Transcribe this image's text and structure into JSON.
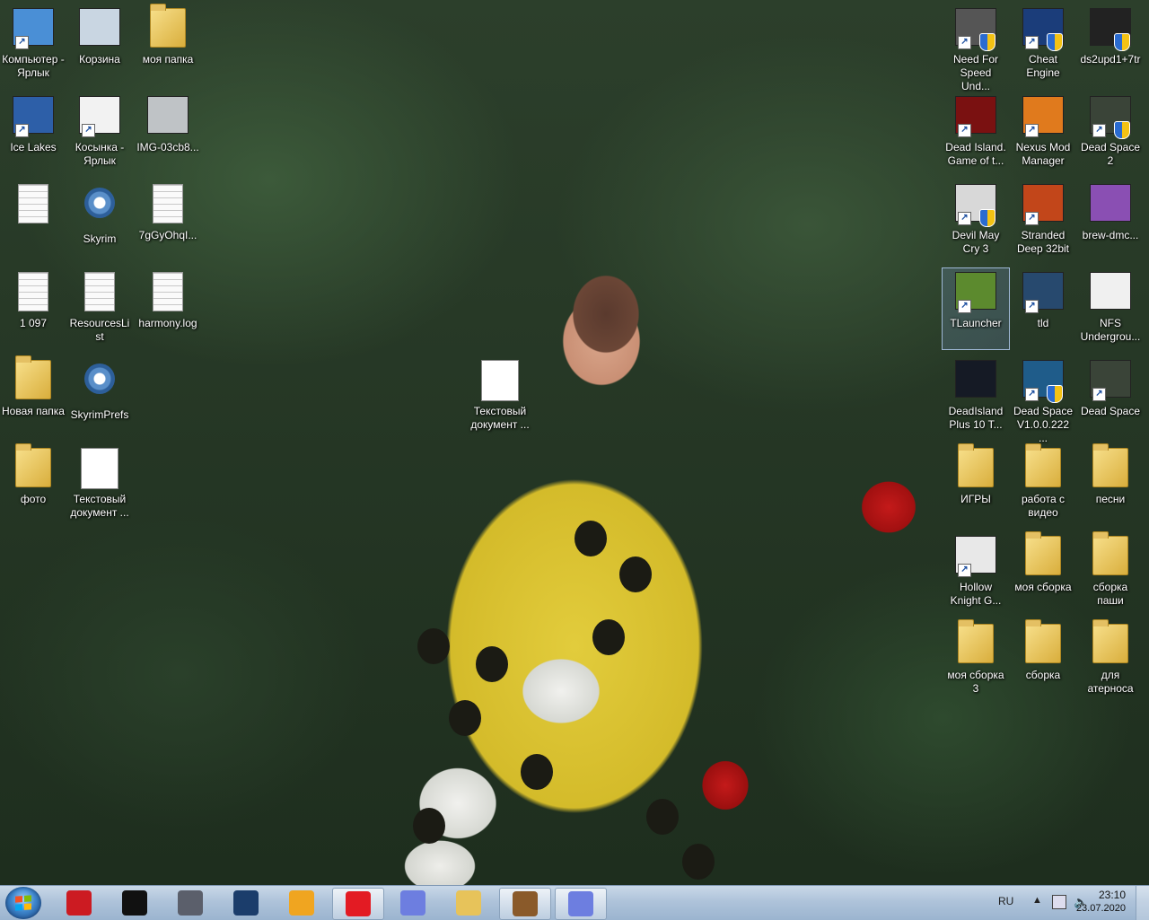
{
  "desktop": {
    "left_icons": [
      {
        "label": "Компьютер - Ярлык",
        "kind": "computer",
        "shortcut": true
      },
      {
        "label": "Корзина",
        "kind": "recycle-bin",
        "shortcut": false
      },
      {
        "label": "моя папка",
        "kind": "folder",
        "shortcut": false
      },
      {
        "label": "Ice Lakes",
        "kind": "game",
        "shortcut": true
      },
      {
        "label": "Косынка - Ярлык",
        "kind": "cards",
        "shortcut": true
      },
      {
        "label": "IMG-03cb8...",
        "kind": "image",
        "shortcut": false
      },
      {
        "label": "",
        "kind": "text-file",
        "shortcut": false
      },
      {
        "label": "Skyrim",
        "kind": "settings-file",
        "shortcut": false
      },
      {
        "label": "7gGyOhqI...",
        "kind": "document",
        "shortcut": false
      },
      {
        "label": "1 097",
        "kind": "text-file",
        "shortcut": false
      },
      {
        "label": "ResourcesList",
        "kind": "xml-file",
        "shortcut": false
      },
      {
        "label": "harmony.log",
        "kind": "text-file",
        "shortcut": false
      },
      {
        "label": "Новая папка",
        "kind": "folder",
        "shortcut": false
      },
      {
        "label": "SkyrimPrefs",
        "kind": "settings-file",
        "shortcut": false
      },
      {
        "label": "фото",
        "kind": "folder",
        "shortcut": false
      },
      {
        "label": "Текстовый документ ...",
        "kind": "blank-document",
        "shortcut": false
      },
      {
        "label": "Текстовый документ ...",
        "kind": "blank-document",
        "shortcut": false
      }
    ],
    "right_icons": [
      {
        "label": "Need For Speed Und...",
        "kind": "nfs",
        "shortcut": true,
        "shield": true
      },
      {
        "label": "Cheat Engine",
        "kind": "cheat-engine",
        "shortcut": true,
        "shield": true
      },
      {
        "label": "ds2upd1+7tr",
        "kind": "trainer",
        "shortcut": false,
        "shield": true
      },
      {
        "label": "Dead Island. Game of t...",
        "kind": "dead-island",
        "shortcut": true,
        "shield": false
      },
      {
        "label": "Nexus Mod Manager",
        "kind": "nexus",
        "shortcut": true,
        "shield": false
      },
      {
        "label": "Dead Space 2",
        "kind": "dead-space",
        "shortcut": true,
        "shield": true
      },
      {
        "label": "Devil May Cry 3",
        "kind": "dmc",
        "shortcut": true,
        "shield": true
      },
      {
        "label": "Stranded Deep 32bit",
        "kind": "stranded",
        "shortcut": true,
        "shield": false
      },
      {
        "label": "brew-dmc...",
        "kind": "brew",
        "shortcut": false,
        "shield": false
      },
      {
        "label": "TLauncher",
        "kind": "minecraft",
        "shortcut": true,
        "shield": false
      },
      {
        "label": "tld",
        "kind": "tld",
        "shortcut": true,
        "shield": false
      },
      {
        "label": "NFS Undergrou...",
        "kind": "nfs-files",
        "shortcut": false,
        "shield": false
      },
      {
        "label": "DeadIsland Plus 10 T...",
        "kind": "dead-island-trainer",
        "shortcut": false,
        "shield": false
      },
      {
        "label": "Dead Space V1.0.0.222 ...",
        "kind": "dead-space-trainer",
        "shortcut": true,
        "shield": true
      },
      {
        "label": "Dead Space",
        "kind": "dead-space",
        "shortcut": true,
        "shield": false
      },
      {
        "label": "ИГРЫ",
        "kind": "folder",
        "shortcut": false,
        "shield": false
      },
      {
        "label": "работа с видео",
        "kind": "folder",
        "shortcut": false,
        "shield": false
      },
      {
        "label": "песни",
        "kind": "folder",
        "shortcut": false,
        "shield": false
      },
      {
        "label": "Hollow Knight G...",
        "kind": "hollow-knight",
        "shortcut": true,
        "shield": false
      },
      {
        "label": "моя сборка",
        "kind": "folder",
        "shortcut": false,
        "shield": false
      },
      {
        "label": "сборка паши",
        "kind": "folder",
        "shortcut": false,
        "shield": false
      },
      {
        "label": "моя сборка 3",
        "kind": "folder",
        "shortcut": false,
        "shield": false
      },
      {
        "label": "сборка",
        "kind": "folder",
        "shortcut": false,
        "shield": false
      },
      {
        "label": "для атерноса",
        "kind": "folder",
        "shortcut": false,
        "shield": false
      }
    ]
  },
  "taskbar": {
    "pinned": [
      {
        "name": "opera",
        "icon": "opera-icon",
        "color": "#cc1b22",
        "active": false
      },
      {
        "name": "terminal-app",
        "icon": "t-app-icon",
        "color": "#111111",
        "active": false
      },
      {
        "name": "game-app",
        "icon": "assassin-icon",
        "color": "#5b5f6b",
        "active": false
      },
      {
        "name": "steam",
        "icon": "steam-icon",
        "color": "#1b3d6b",
        "active": false
      },
      {
        "name": "duck-app",
        "icon": "duck-icon",
        "color": "#f0a520",
        "active": false
      },
      {
        "name": "yandex",
        "icon": "yandex-icon",
        "color": "#e31b23",
        "active": true
      },
      {
        "name": "discord",
        "icon": "discord-icon",
        "color": "#6d7ee0",
        "active": false
      },
      {
        "name": "explorer",
        "icon": "folder-icon",
        "color": "#e7c35a",
        "active": false
      },
      {
        "name": "minecraft",
        "icon": "minecraft-icon",
        "color": "#8a5a2a",
        "active": true
      },
      {
        "name": "discord",
        "icon": "discord-icon",
        "color": "#6d7ee0",
        "active": true
      }
    ],
    "tray": {
      "language": "RU",
      "clock_time": "23:10",
      "clock_date": "23.07.2020"
    }
  }
}
